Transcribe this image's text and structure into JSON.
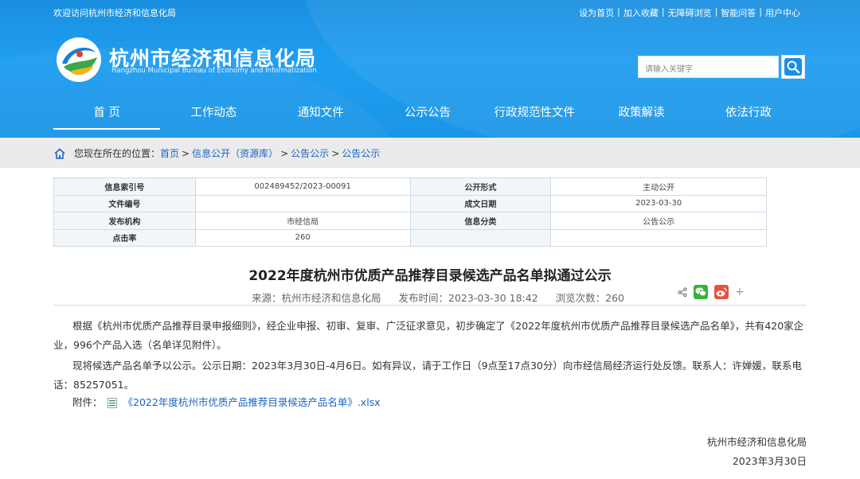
{
  "header": {
    "welcome": "欢迎访问杭州市经济和信息化局",
    "toplinks": [
      "设为首页",
      "加入收藏",
      "无障碍浏览",
      "智能问答",
      "用户中心"
    ],
    "title": "杭州市经济和信息化局",
    "subtitle": "Hangzhou Municipal Bureau of Economy and Informatization",
    "search_placeholder": "请输入关键字"
  },
  "nav": [
    "首 页",
    "工作动态",
    "通知文件",
    "公示公告",
    "行政规范性文件",
    "政策解读",
    "依法行政"
  ],
  "breadcrumb": {
    "prefix": "您现在所在的位置：",
    "items": [
      "首页",
      "信息公开（资源库）",
      "公告公示",
      "公告公示"
    ]
  },
  "info": {
    "rows": [
      {
        "k1": "信息索引号",
        "v1": "002489452/2023-00091",
        "k2": "公开形式",
        "v2": "主动公开"
      },
      {
        "k1": "文件编号",
        "v1": "",
        "k2": "成文日期",
        "v2": "2023-03-30"
      },
      {
        "k1": "发布机构",
        "v1": "市经信局",
        "k2": "信息分类",
        "v2": "公告公示"
      },
      {
        "k1": "点击率",
        "v1": "260",
        "k2": "",
        "v2": ""
      }
    ]
  },
  "article": {
    "title": "2022年度杭州市优质产品推荐目录候选产品名单拟通过公示",
    "source": "来源：杭州市经济和信息化局",
    "published": "发布时间：2023-03-30 18:42",
    "views": "浏览次数：260",
    "plus": "+",
    "para1": "根据《杭州市优质产品推荐目录申报细则》，经企业申报、初审、复审、广泛征求意见，初步确定了《2022年度杭州市优质产品推荐目录候选产品名单》，共有420家企业，996个产品入选（名单详见附件）。",
    "para2": "现将候选产品名单予以公示。公示日期：2023年3月30日-4月6日。如有异议，请于工作日（9点至17点30分）向市经信局经济运行处反馈。联系人：许婵媛，联系电话：85257051。",
    "attach_label": "附件：",
    "attach_name": "《2022年度杭州市优质产品推荐目录候选产品名单》.xlsx",
    "sign_org": "杭州市经济和信息化局",
    "sign_date": "2023年3月30日"
  }
}
